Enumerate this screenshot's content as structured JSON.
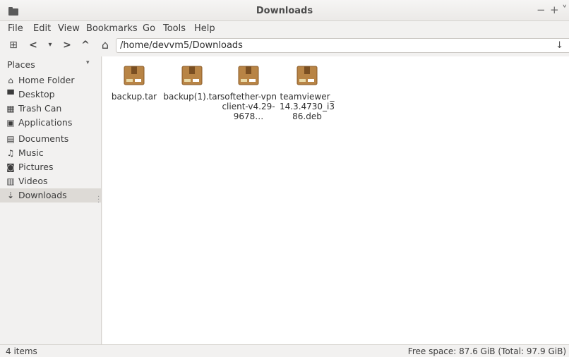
{
  "window": {
    "title": "Downloads",
    "minimize_glyph": "−",
    "maximize_glyph": "+",
    "close_glyph": "˅"
  },
  "menubar": {
    "items": [
      "File",
      "Edit",
      "View",
      "Bookmarks",
      "Go",
      "Tools",
      "Help"
    ]
  },
  "toolbar": {
    "new_tab_glyph": "⊞",
    "back_glyph": "<",
    "history_glyph": "▾",
    "forward_glyph": ">",
    "up_glyph": "^",
    "home_glyph": "⌂",
    "location_value": "/home/devvm5/Downloads",
    "go_glyph": "↓"
  },
  "sidebar": {
    "header": "Places",
    "header_arrow": "▾",
    "items": [
      {
        "label": "Home Folder",
        "icon": "home-icon",
        "glyph": "⌂"
      },
      {
        "label": "Desktop",
        "icon": "desktop-icon",
        "glyph": "▀"
      },
      {
        "label": "Trash Can",
        "icon": "trash-icon",
        "glyph": "▦"
      },
      {
        "label": "Applications",
        "icon": "applications-icon",
        "glyph": "▣"
      },
      {
        "label": "Documents",
        "icon": "documents-icon",
        "glyph": "▤"
      },
      {
        "label": "Music",
        "icon": "music-icon",
        "glyph": "♫"
      },
      {
        "label": "Pictures",
        "icon": "pictures-icon",
        "glyph": "◙"
      },
      {
        "label": "Videos",
        "icon": "videos-icon",
        "glyph": "▥"
      },
      {
        "label": "Downloads",
        "icon": "downloads-icon",
        "glyph": "⇣"
      }
    ],
    "selected": "Downloads"
  },
  "files": [
    {
      "name": "backup.tar",
      "icon": "archive-icon"
    },
    {
      "name": "backup(1).tar",
      "icon": "archive-icon"
    },
    {
      "name": "softether-vpnclient-v4.29-9678…",
      "icon": "archive-icon"
    },
    {
      "name": "teamviewer_14.3.4730_i386.deb",
      "icon": "package-icon"
    }
  ],
  "status": {
    "item_count": "4 items",
    "free_space": "Free space: 87.6 GiB (Total: 97.9 GiB)"
  },
  "colors": {
    "package_brown": "#b07a3c",
    "package_tape": "#8a5a26",
    "selection": "#dddad6"
  }
}
